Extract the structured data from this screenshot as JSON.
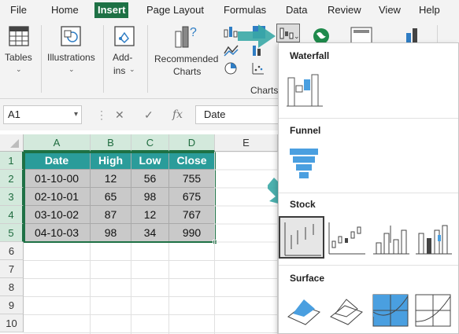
{
  "menu": {
    "items": [
      "File",
      "Home",
      "Insert",
      "Page Layout",
      "Formulas",
      "Data",
      "Review",
      "View",
      "Help"
    ],
    "active": "Insert"
  },
  "ribbon": {
    "tables_label": "Tables",
    "illustrations_label": "Illustrations",
    "addins_label_1": "Add-",
    "addins_label_2": "ins",
    "recommended_label_1": "Recommended",
    "recommended_label_2": "Charts",
    "charts_group_label": "Charts"
  },
  "formula_bar": {
    "name_box": "A1",
    "cancel_symbol": "✕",
    "enter_symbol": "✓",
    "fx_symbol": "fx",
    "formula_value": "Date"
  },
  "sheet": {
    "columns": [
      "A",
      "B",
      "C",
      "D",
      "E"
    ],
    "rows": [
      "1",
      "2",
      "3",
      "4",
      "5",
      "6",
      "7",
      "8",
      "9",
      "10"
    ],
    "table": {
      "headers": [
        "Date",
        "High",
        "Low",
        "Close"
      ],
      "rows": [
        [
          "01-10-00",
          "12",
          "56",
          "755"
        ],
        [
          "02-10-01",
          "65",
          "98",
          "675"
        ],
        [
          "03-10-02",
          "87",
          "12",
          "767"
        ],
        [
          "04-10-03",
          "98",
          "34",
          "990"
        ]
      ]
    }
  },
  "dropdown": {
    "sections": [
      "Waterfall",
      "Funnel",
      "Stock",
      "Surface"
    ]
  },
  "colors": {
    "excel_green": "#1e7145",
    "header_teal": "#2a9c9a",
    "data_gray": "#c9c9c9",
    "arrow_teal": "#3aa8a6",
    "chart_blue": "#4a9fe0"
  }
}
